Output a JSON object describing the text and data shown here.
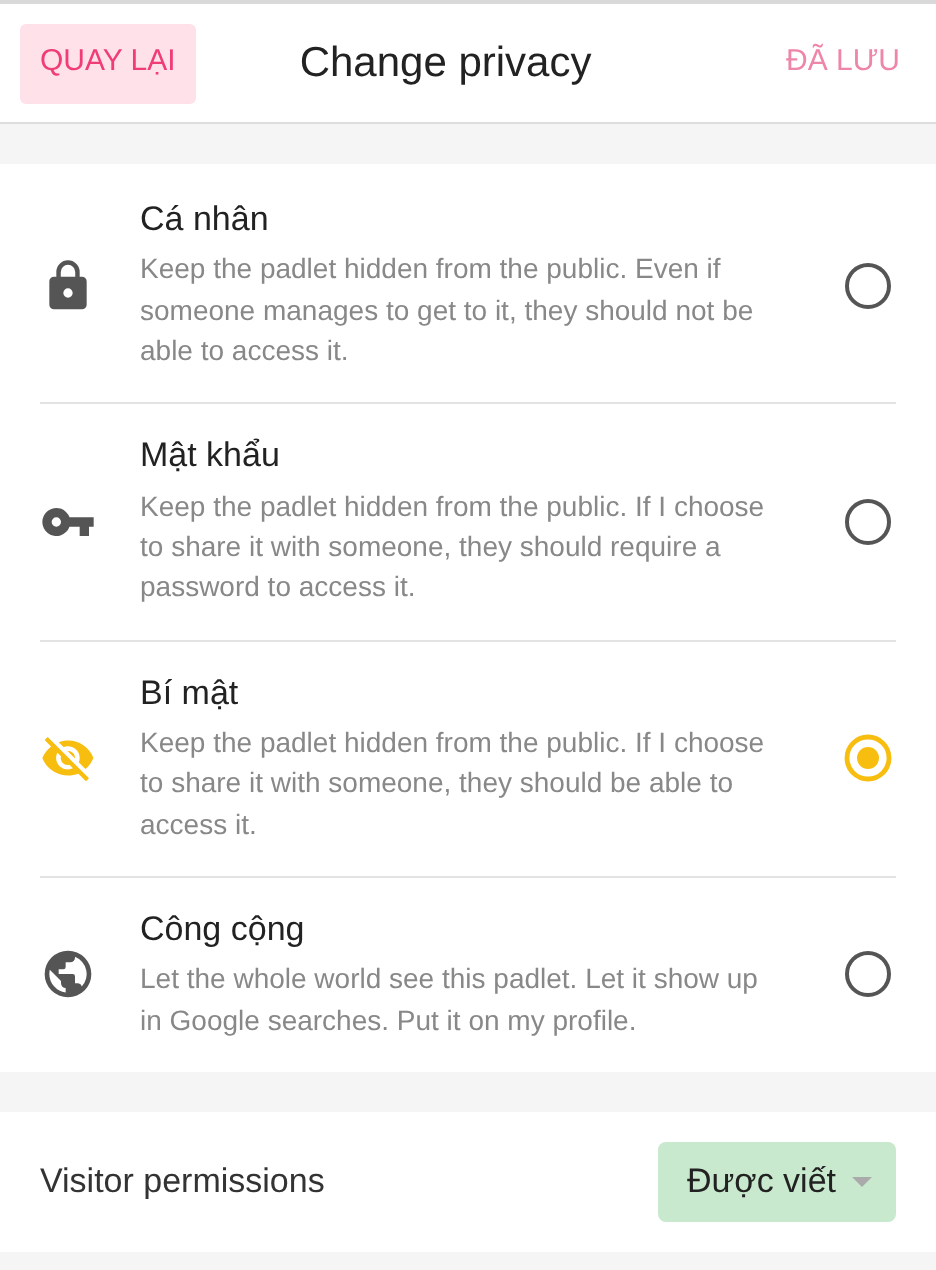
{
  "header": {
    "back_button": "QUAY LẠI",
    "title": "Change privacy",
    "save_button": {
      "label": "ĐÃ LƯU",
      "disabled": true
    }
  },
  "options": [
    {
      "kind": "lock",
      "title": "Cá nhân",
      "description": "Keep the padlet hidden from the public. Even if someone manages to get to it, they should not be able to access it.",
      "selected": false
    },
    {
      "kind": "key",
      "title": "Mật khẩu",
      "description": "Keep the padlet hidden from the public. If I choose to share it with someone, they should require a password to access it.",
      "selected": false
    },
    {
      "kind": "hidden",
      "title": "Bí mật",
      "description": "Keep the padlet hidden from the public. If I choose to share it with someone, they should be able to access it.",
      "selected": true
    },
    {
      "kind": "globe",
      "title": "Công cộng",
      "description": "Let the whole world see this padlet. Let it show up in Google searches. Put it on my profile.",
      "selected": false
    }
  ],
  "visitor_permissions": {
    "label": "Visitor permissions",
    "value": "Được viết"
  }
}
